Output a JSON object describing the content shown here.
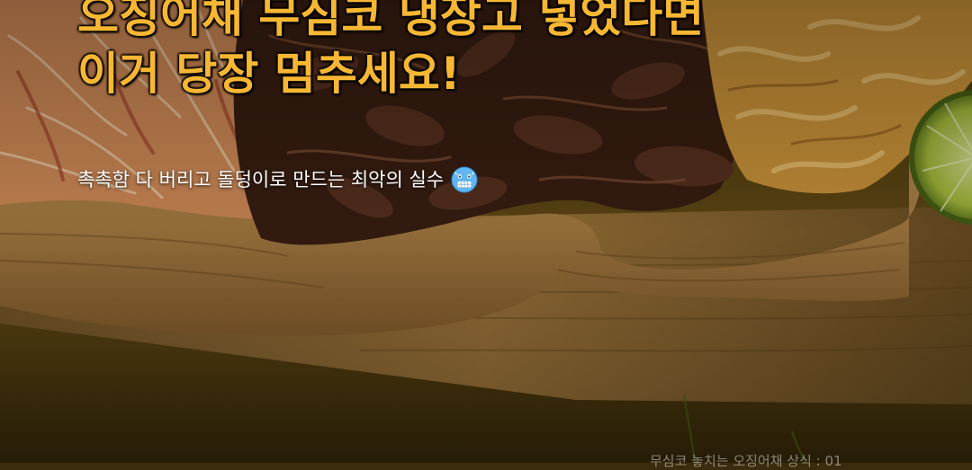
{
  "headline": {
    "line1": "오징어채 무심코 냉장고 넣었다면",
    "line2": "이거 당장 멈추세요!"
  },
  "subtitle": {
    "text": "촉촉함 다 버리고 돌덩이로 만드는 최악의 실수",
    "emoji": "cold-face-emoji"
  },
  "caption": "무심코 놓치는 오징어채 상식 : 01",
  "colors": {
    "headline": "#f7b733",
    "table": "#5e4612",
    "board": "#b88a4a",
    "lime": "#b7c94a"
  }
}
